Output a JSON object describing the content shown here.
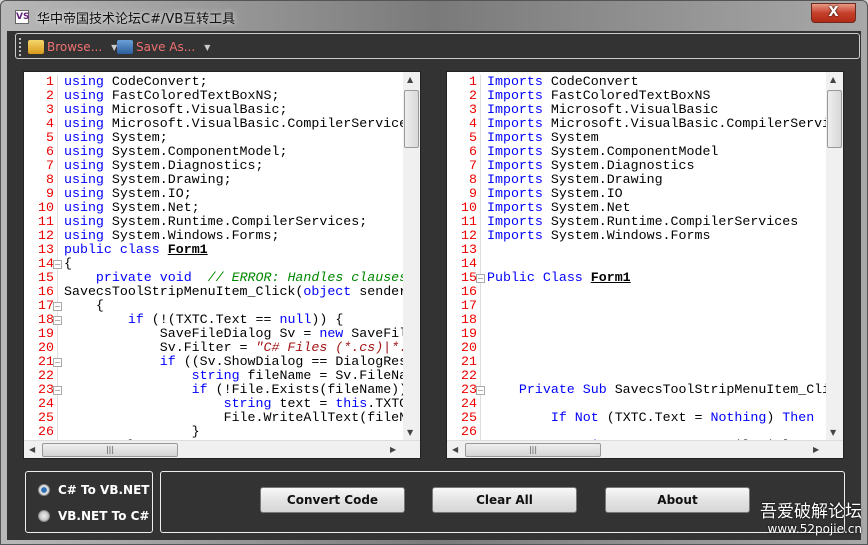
{
  "window": {
    "title": "华中帝国技术论坛C#/VB互转工具",
    "close_label": "X",
    "icon": "visual-studio-icon"
  },
  "toolbar": {
    "browse_label": "Browse...",
    "save_label": "Save As...",
    "browse_icon": "folder-open-icon",
    "save_icon": "floppy-disk-icon"
  },
  "left_editor": {
    "lines": [
      [
        [
          "using",
          "kw"
        ],
        [
          " CodeConvert;",
          ""
        ]
      ],
      [
        [
          "using",
          "kw"
        ],
        [
          " FastColoredTextBoxNS;",
          ""
        ]
      ],
      [
        [
          "using",
          "kw"
        ],
        [
          " Microsoft.VisualBasic;",
          ""
        ]
      ],
      [
        [
          "using",
          "kw"
        ],
        [
          " Microsoft.VisualBasic.CompilerServices;",
          ""
        ]
      ],
      [
        [
          "using",
          "kw"
        ],
        [
          " System;",
          ""
        ]
      ],
      [
        [
          "using",
          "kw"
        ],
        [
          " System.ComponentModel;",
          ""
        ]
      ],
      [
        [
          "using",
          "kw"
        ],
        [
          " System.Diagnostics;",
          ""
        ]
      ],
      [
        [
          "using",
          "kw"
        ],
        [
          " System.Drawing;",
          ""
        ]
      ],
      [
        [
          "using",
          "kw"
        ],
        [
          " System.IO;",
          ""
        ]
      ],
      [
        [
          "using",
          "kw"
        ],
        [
          " System.Net;",
          ""
        ]
      ],
      [
        [
          "using",
          "kw"
        ],
        [
          " System.Runtime.CompilerServices;",
          ""
        ]
      ],
      [
        [
          "using",
          "kw"
        ],
        [
          " System.Windows.Forms;",
          ""
        ]
      ],
      [
        [
          "public",
          "kw"
        ],
        [
          " ",
          ""
        ],
        [
          "class",
          "kw"
        ],
        [
          " ",
          ""
        ],
        [
          "Form1",
          "cl"
        ]
      ],
      [
        [
          "{",
          ""
        ]
      ],
      [
        [
          "    ",
          ""
        ],
        [
          "private",
          "kw"
        ],
        [
          " ",
          ""
        ],
        [
          "void",
          "kw"
        ],
        [
          "  ",
          ""
        ],
        [
          "// ERROR: Handles clauses",
          "cm"
        ]
      ],
      [
        [
          "SavecsToolStripMenuItem_Click(",
          ""
        ],
        [
          "object",
          "kw"
        ],
        [
          " sender",
          ""
        ]
      ],
      [
        [
          "    {",
          ""
        ]
      ],
      [
        [
          "        ",
          ""
        ],
        [
          "if",
          "kw"
        ],
        [
          " (!(TXTC.Text == ",
          ""
        ],
        [
          "null",
          "kw"
        ],
        [
          ")) {",
          ""
        ]
      ],
      [
        [
          "            SaveFileDialog Sv = ",
          ""
        ],
        [
          "new",
          "kw"
        ],
        [
          " SaveFileDialog",
          ""
        ]
      ],
      [
        [
          "            Sv.Filter = ",
          ""
        ],
        [
          "\"C# Files (*.cs)|*.cs\"",
          "st"
        ]
      ],
      [
        [
          "            ",
          ""
        ],
        [
          "if",
          "kw"
        ],
        [
          " ((Sv.ShowDialog == DialogResult",
          ""
        ]
      ],
      [
        [
          "                ",
          ""
        ],
        [
          "string",
          "kw"
        ],
        [
          " fileName = Sv.FileName",
          ""
        ]
      ],
      [
        [
          "                ",
          ""
        ],
        [
          "if",
          "kw"
        ],
        [
          " (!File.Exists(fileName))",
          ""
        ]
      ],
      [
        [
          "                    ",
          ""
        ],
        [
          "string",
          "kw"
        ],
        [
          " text = ",
          ""
        ],
        [
          "this",
          "kw"
        ],
        [
          ".TXTC",
          ""
        ]
      ],
      [
        [
          "                    File.WriteAllText(fileName",
          ""
        ]
      ],
      [
        [
          "                }",
          ""
        ]
      ],
      [
        [
          "        }",
          ""
        ]
      ]
    ],
    "fold_lines": [
      14,
      17,
      18,
      21,
      23
    ]
  },
  "right_editor": {
    "lines": [
      [
        [
          "Imports",
          "kw"
        ],
        [
          " CodeConvert",
          ""
        ]
      ],
      [
        [
          "Imports",
          "kw"
        ],
        [
          " FastColoredTextBoxNS",
          ""
        ]
      ],
      [
        [
          "Imports",
          "kw"
        ],
        [
          " Microsoft.VisualBasic",
          ""
        ]
      ],
      [
        [
          "Imports",
          "kw"
        ],
        [
          " Microsoft.VisualBasic.CompilerServices",
          ""
        ]
      ],
      [
        [
          "Imports",
          "kw"
        ],
        [
          " System",
          ""
        ]
      ],
      [
        [
          "Imports",
          "kw"
        ],
        [
          " System.ComponentModel",
          ""
        ]
      ],
      [
        [
          "Imports",
          "kw"
        ],
        [
          " System.Diagnostics",
          ""
        ]
      ],
      [
        [
          "Imports",
          "kw"
        ],
        [
          " System.Drawing",
          ""
        ]
      ],
      [
        [
          "Imports",
          "kw"
        ],
        [
          " System.IO",
          ""
        ]
      ],
      [
        [
          "Imports",
          "kw"
        ],
        [
          " System.Net",
          ""
        ]
      ],
      [
        [
          "Imports",
          "kw"
        ],
        [
          " System.Runtime.CompilerServices",
          ""
        ]
      ],
      [
        [
          "Imports",
          "kw"
        ],
        [
          " System.Windows.Forms",
          ""
        ]
      ],
      [],
      [],
      [
        [
          "Public",
          "kw"
        ],
        [
          " ",
          ""
        ],
        [
          "Class",
          "kw"
        ],
        [
          " ",
          ""
        ],
        [
          "Form1",
          "cl"
        ]
      ],
      [],
      [],
      [],
      [],
      [],
      [],
      [],
      [
        [
          "    ",
          ""
        ],
        [
          "Private",
          "kw"
        ],
        [
          " ",
          ""
        ],
        [
          "Sub",
          "kw"
        ],
        [
          " SavecsToolStripMenuItem_Click",
          ""
        ]
      ],
      [],
      [
        [
          "        ",
          ""
        ],
        [
          "If",
          "kw"
        ],
        [
          " ",
          ""
        ],
        [
          "Not",
          "kw"
        ],
        [
          " (TXTC.Text = ",
          ""
        ],
        [
          "Nothing",
          "kw"
        ],
        [
          ") ",
          ""
        ],
        [
          "Then",
          "kw"
        ]
      ],
      [],
      [
        [
          "            ",
          ""
        ],
        [
          "Dim",
          "kw"
        ],
        [
          " Sv ",
          ""
        ],
        [
          "As",
          "kw"
        ],
        [
          " ",
          ""
        ],
        [
          "New",
          "kw"
        ],
        [
          " SaveFileDialog",
          ""
        ]
      ]
    ],
    "fold_lines": [
      15,
      23
    ]
  },
  "mode": {
    "options": [
      "C# To VB.NET",
      "VB.NET To C#"
    ],
    "selected": "C# To VB.NET"
  },
  "buttons": {
    "convert": "Convert Code",
    "clear": "Clear All",
    "about": "About"
  },
  "watermark": {
    "line1": "吾爱破解论坛",
    "line2": "www.52pojie.cn"
  }
}
